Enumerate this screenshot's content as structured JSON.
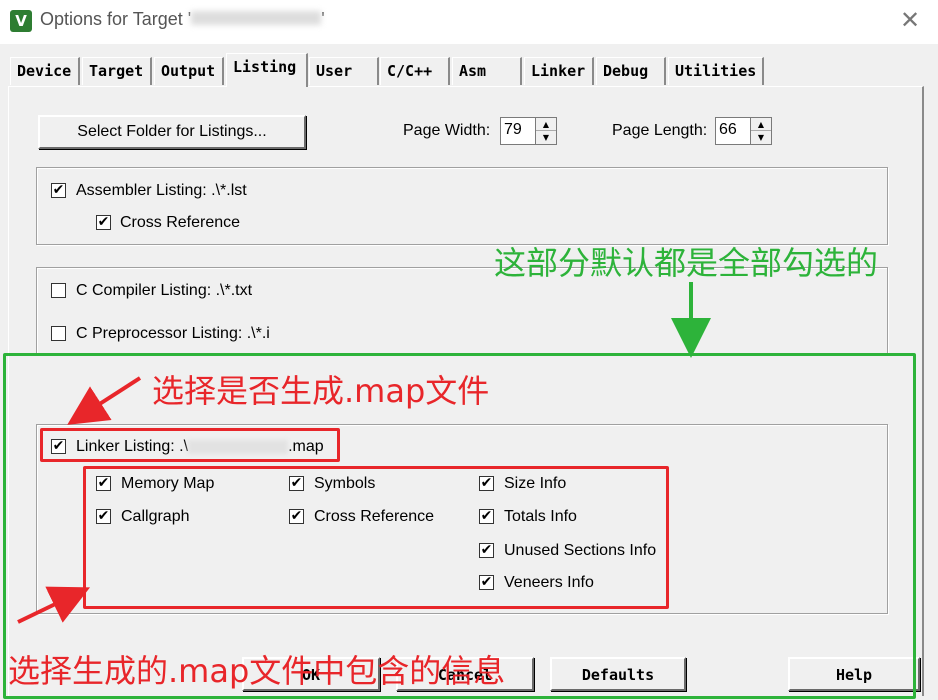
{
  "window": {
    "title": "Options for Target '",
    "title_suffix": "'",
    "close": "✕",
    "app_icon": "V"
  },
  "tabs": [
    "Device",
    "Target",
    "Output",
    "Listing",
    "User",
    "C/C++",
    "Asm",
    "Linker",
    "Debug",
    "Utilities"
  ],
  "active_tab": "Listing",
  "select_folder_label": "Select Folder for Listings...",
  "page_width": {
    "label": "Page Width:",
    "value": "79"
  },
  "page_length": {
    "label": "Page Length:",
    "value": "66"
  },
  "assembler": {
    "label": "Assembler Listing:  .\\*.lst",
    "checked": true,
    "cross_ref": {
      "label": "Cross Reference",
      "checked": true
    }
  },
  "c_compiler": {
    "label": "C Compiler Listing:  .\\*.txt",
    "checked": false
  },
  "c_preprocessor": {
    "label": "C Preprocessor Listing:  .\\*.i",
    "checked": false
  },
  "linker": {
    "label_prefix": "Linker Listing:  .\\",
    "label_suffix": ".map",
    "checked": true,
    "options": {
      "memory_map": "Memory Map",
      "callgraph": "Callgraph",
      "symbols": "Symbols",
      "cross_reference": "Cross Reference",
      "size_info": "Size Info",
      "totals_info": "Totals Info",
      "unused_sections": "Unused Sections Info",
      "veneers_info": "Veneers Info"
    }
  },
  "check_mark": "✔",
  "buttons": {
    "ok": "OK",
    "cancel": "Cancel",
    "defaults": "Defaults",
    "help": "Help"
  },
  "annotations": {
    "default_all_checked": "这部分默认都是全部勾选的",
    "select_map": "选择是否生成.map文件",
    "map_contents": "选择生成的.map文件中包含的信息"
  },
  "colors": {
    "annotation_red": "#e8262a",
    "annotation_green": "#2db33a"
  }
}
